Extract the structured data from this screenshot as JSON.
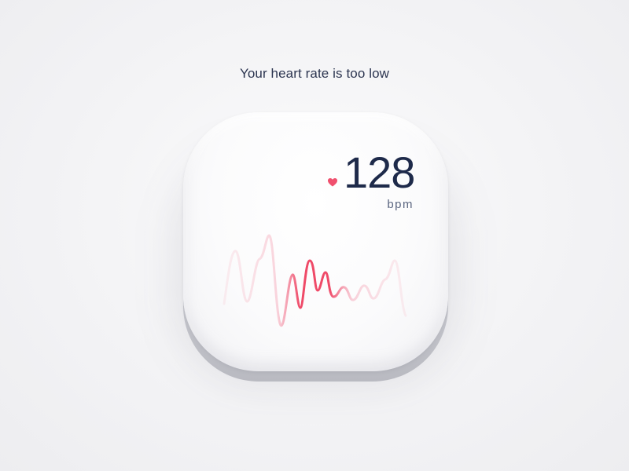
{
  "alert": {
    "message": "Your heart rate is too low"
  },
  "reading": {
    "value": "128",
    "unit": "bpm",
    "icon": "heart-icon"
  },
  "colors": {
    "accent": "#f0506e",
    "text_primary": "#1e2a4a",
    "text_secondary": "#5b6680"
  }
}
